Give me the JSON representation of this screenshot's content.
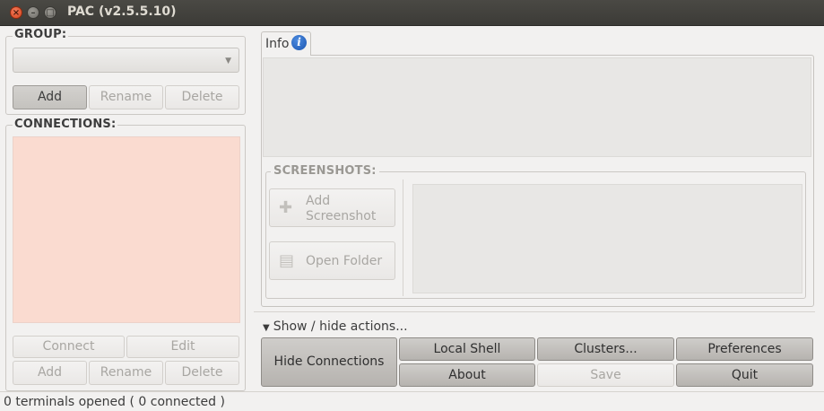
{
  "window": {
    "title": "PAC (v2.5.5.10)"
  },
  "group": {
    "label": "GROUP:",
    "selected": "",
    "buttons": {
      "add": "Add",
      "rename": "Rename",
      "delete": "Delete"
    }
  },
  "connections": {
    "label": "CONNECTIONS:",
    "buttons": {
      "connect": "Connect",
      "edit": "Edit",
      "add": "Add",
      "rename": "Rename",
      "delete": "Delete"
    }
  },
  "tabs": [
    {
      "label": "Info",
      "icon": "info-icon"
    }
  ],
  "screenshots": {
    "label": "SCREENSHOTS:",
    "add_line1": "Add",
    "add_line2": "Screenshot",
    "open_folder": "Open Folder"
  },
  "actions": {
    "toggle": "Show / hide actions...",
    "hide_connections": "Hide Connections",
    "local_shell": "Local Shell",
    "clusters": "Clusters...",
    "preferences": "Preferences",
    "about": "About",
    "save": "Save",
    "quit": "Quit"
  },
  "status": {
    "text": "0 terminals opened ( 0 connected )"
  },
  "colors": {
    "titlebar": "#3c3b37",
    "connections_bg": "#fadbd0",
    "info_icon": "#1b55b0",
    "close_button": "#d6451e"
  }
}
